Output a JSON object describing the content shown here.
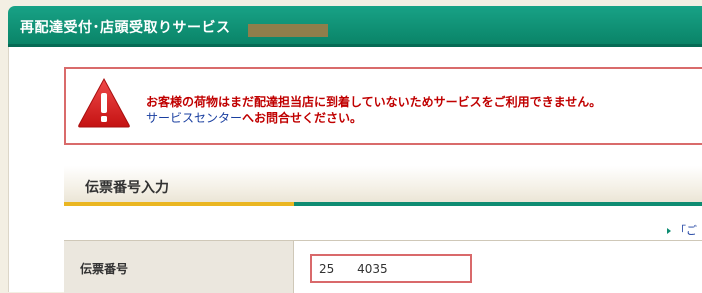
{
  "header": {
    "title": "再配達受付･店頭受取りサービス"
  },
  "alert": {
    "message_line1": "お客様の荷物はまだ配達担当店に到着していないためサービスをご利用できません。",
    "link_text": "サービスセンター",
    "message_line2_rest": "へお問合せください。"
  },
  "section": {
    "title": "伝票番号入力"
  },
  "help": {
    "link_text": "「ご"
  },
  "form": {
    "tracking_label": "伝票番号",
    "tracking_value": "25      4035"
  },
  "colors": {
    "header_green": "#0a8468",
    "alert_red": "#c00000",
    "alert_border": "#d96b6b",
    "link_blue": "#1a3fa0",
    "accent_yellow": "#eab622",
    "accent_green": "#0e8c72",
    "redaction": "#9a7d48"
  },
  "icons": {
    "alert": "warning-icon",
    "help_arrow": "arrow-right-icon"
  }
}
